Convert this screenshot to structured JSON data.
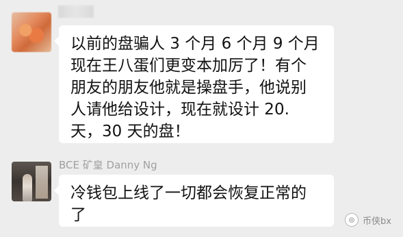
{
  "messages": [
    {
      "lines": [
        "以前的盘骗人 3 个月 6 个月 9 个月",
        "现在王八蛋们更变本加厉了！有个",
        "朋友的朋友他就是操盘手，他说别",
        "人请他给设计，现在就设计 20.",
        "天，30 天的盘！"
      ]
    },
    {
      "sender": "BCE 矿皇 Danny Ng",
      "lines": [
        "冷钱包上线了一切都会恢复正常的",
        "了"
      ]
    }
  ],
  "watermark": {
    "text": "币侠bx",
    "icon": "wechat-icon"
  }
}
